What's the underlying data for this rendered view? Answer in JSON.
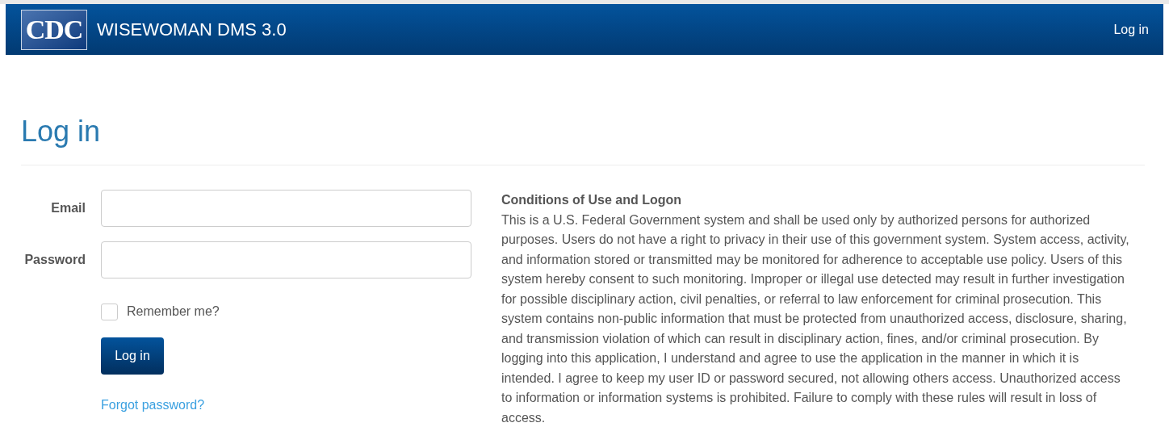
{
  "header": {
    "logo": "CDC",
    "title": "WISEWOMAN DMS 3.0",
    "nav_link": "Log in"
  },
  "page_title": "Log in",
  "form": {
    "fields": [
      {
        "label": "Email"
      },
      {
        "label": "Password"
      }
    ],
    "remember": {
      "label": "Remember me?",
      "checked": false
    },
    "submit": "Log in",
    "forgot_link": "Forgot password?"
  },
  "conditions": {
    "heading": "Conditions of Use and Logon",
    "text": "This is a U.S. Federal Government system and shall be used only by authorized persons for authorized purposes. Users do not have a right to privacy in their use of this government system. System access, activity, and information stored or transmitted may be monitored for adherence to acceptable use policy. Users of this system hereby consent to such monitoring. Improper or illegal use detected may result in further investigation for possible disciplinary action, civil penalties, or referral to law enforcement for criminal prosecution. This system contains non-public information that must be protected from unauthorized access, disclosure, sharing, and transmission violation of which can result in disciplinary action, fines, and/or criminal prosecution. By logging into this application, I understand and agree to use the application in the manner in which it is intended. I agree to keep my user ID or password secured, not allowing others access. Unauthorized access to information or information systems is prohibited. Failure to comply with these rules will result in loss of access."
  }
}
